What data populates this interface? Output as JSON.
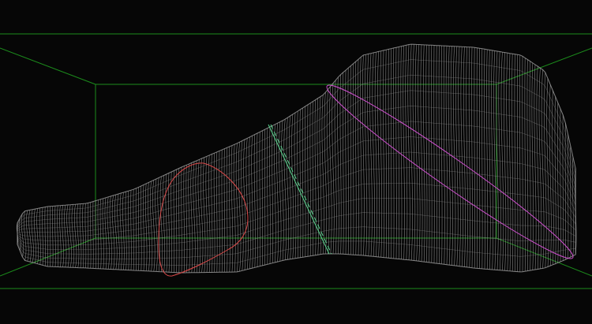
{
  "viewport": {
    "background_color": "#060606",
    "bounding_box_color": "#1c8c1c",
    "mesh_color": "#9a9a9a",
    "toe_section_color": "#d84848",
    "instep_section_color": "#5ad890",
    "heel_section_color": "#d050d0",
    "bounding_box_icon": "wireframe-box-icon",
    "model_icon": "foot-mesh-icon"
  }
}
